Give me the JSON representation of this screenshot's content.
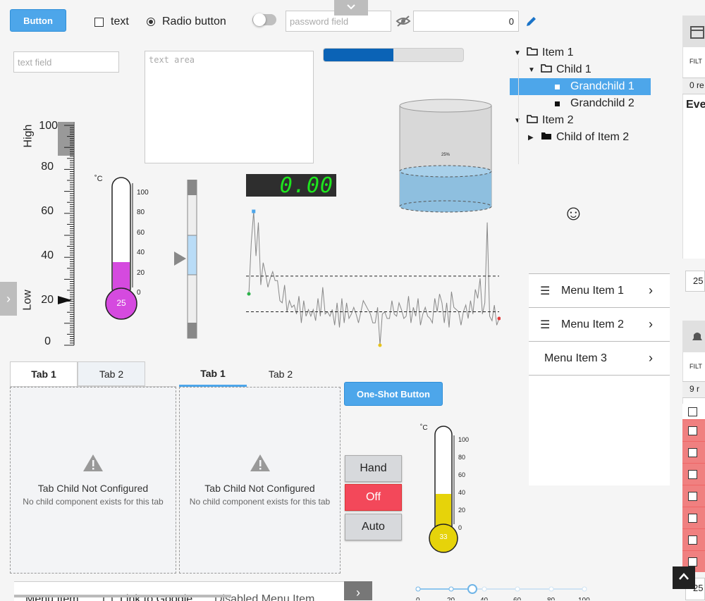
{
  "top": {
    "button_label": "Button",
    "checkbox_label": "text",
    "radio_label": "Radio button",
    "password_placeholder": "password field",
    "numeric_value": "0",
    "collapse_icon": "chevron-down-icon"
  },
  "fields": {
    "text_field_placeholder": "text field",
    "text_area_placeholder": "text area"
  },
  "progress": {
    "value": 0.5,
    "color": "#0b63b6"
  },
  "tree": {
    "items": [
      {
        "label": "Item 1",
        "level": 0,
        "expanded": true,
        "icon": "folder-open-icon"
      },
      {
        "label": "Child 1",
        "level": 1,
        "expanded": true,
        "icon": "folder-open-icon"
      },
      {
        "label": "Grandchild 1",
        "level": 2,
        "selected": true,
        "icon": "square-icon"
      },
      {
        "label": "Grandchild 2",
        "level": 2,
        "icon": "square-icon"
      },
      {
        "label": "Item 2",
        "level": 0,
        "expanded": true,
        "icon": "folder-open-icon"
      },
      {
        "label": "Child of Item 2",
        "level": 1,
        "expanded": false,
        "icon": "folder-icon"
      }
    ]
  },
  "linear_scale": {
    "ticks": [
      "100",
      "80",
      "60",
      "40",
      "20",
      "0"
    ],
    "high_label": "High",
    "low_label": "Low",
    "pointer_value": 20,
    "high_value": 100
  },
  "thermometer1": {
    "unit": "˚C",
    "ticks": [
      "100",
      "80",
      "60",
      "40",
      "20",
      "0"
    ],
    "value": "25",
    "fill_color": "#d54adf"
  },
  "thermometer2": {
    "unit": "˚C",
    "ticks": [
      "100",
      "80",
      "60",
      "40",
      "20",
      "0"
    ],
    "value": "33",
    "fill_color": "#e6d30a"
  },
  "digital_display": {
    "value": "0.00",
    "color": "#1ee61e"
  },
  "tank": {
    "label": "25%",
    "level": 0.25,
    "fill_color": "#8ebfdf"
  },
  "emoji": "☺",
  "sparkline": {
    "values": [
      18,
      41,
      55,
      35,
      50,
      22,
      32,
      27,
      21,
      25,
      28,
      24,
      24,
      15,
      14,
      22,
      10,
      15,
      12,
      13,
      9,
      17,
      5,
      15,
      8,
      11,
      8,
      11,
      6,
      16,
      8,
      21,
      9,
      10,
      8,
      11,
      4,
      14,
      3,
      16,
      5,
      14,
      7,
      9,
      12,
      9,
      5,
      10,
      15,
      13,
      11,
      9,
      5,
      5,
      12,
      -5,
      9,
      10,
      7,
      7,
      15,
      9,
      8,
      14,
      11,
      7,
      8,
      17,
      5,
      12,
      8,
      16,
      4,
      9,
      12,
      8,
      7,
      5,
      16,
      10,
      18,
      14,
      5,
      14,
      3,
      19,
      12,
      11,
      10,
      4,
      10,
      13,
      7,
      15,
      9,
      20,
      16,
      25,
      9,
      14,
      50,
      8,
      6,
      13,
      4,
      7
    ],
    "high_line": 26,
    "low_line": 10,
    "first_color": "#2db24a",
    "max_color": "#4da6ea",
    "min_color": "#e6c21a",
    "last_color": "#e23b3b"
  },
  "menu": {
    "items": [
      {
        "label": "Menu Item 1",
        "icon": "list-icon"
      },
      {
        "label": "Menu Item 2",
        "icon": "list-icon"
      },
      {
        "label": "Menu Item 3",
        "icon": ""
      }
    ]
  },
  "tabs_left": {
    "tabs": [
      "Tab 1",
      "Tab 2"
    ]
  },
  "tabs_right": {
    "tabs": [
      "Tab 1",
      "Tab 2"
    ]
  },
  "empty_panel": {
    "title": "Tab Child Not Configured",
    "subtitle": "No child component exists for this tab"
  },
  "one_shot_label": "One-Shot Button",
  "multistate": {
    "buttons": [
      "Hand",
      "Off",
      "Auto"
    ],
    "active_color": "#f3485a"
  },
  "slider": {
    "ticks": [
      "0",
      "20",
      "40",
      "60",
      "80",
      "100"
    ],
    "value": 40
  },
  "horizontal_menu": {
    "items": [
      "Menu Item",
      "Link to Google",
      "Disabled Menu Item"
    ]
  },
  "right_panel": {
    "filter_label": "FILT",
    "records1": "0 re",
    "events_label": "Eve",
    "page_size1": "25",
    "filter_label2": "FILT",
    "records2": "9 r",
    "page_size2": "25"
  }
}
